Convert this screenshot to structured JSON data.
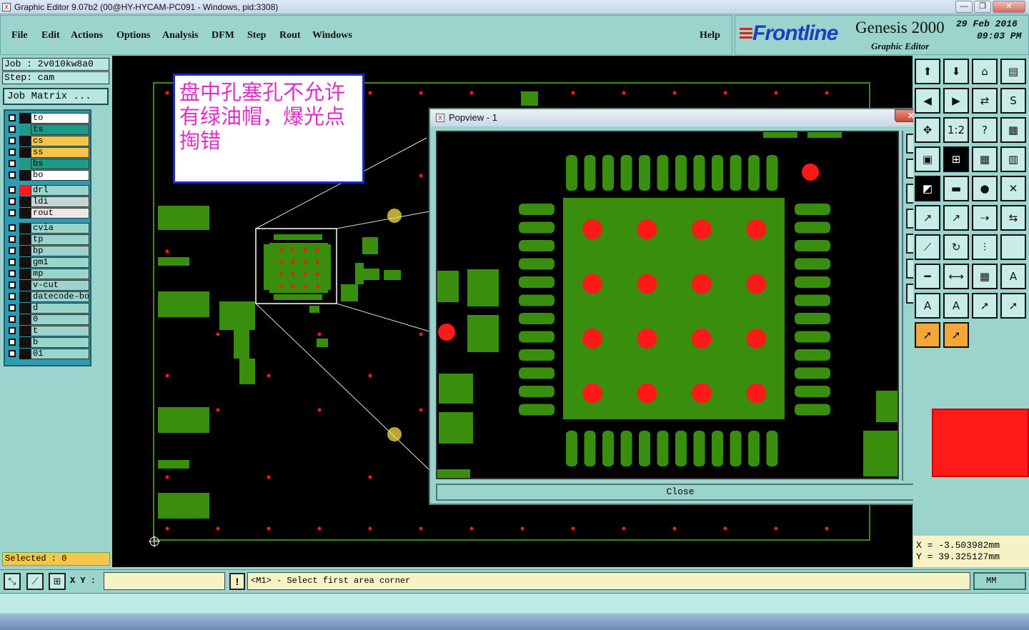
{
  "window": {
    "title": "Graphic Editor 9.07b2 (00@HY-HYCAM-PC091 - Windows, pid:3308)",
    "app_icon": "X",
    "minimize": "—",
    "maximize": "❐",
    "close": "✕"
  },
  "menu": {
    "items": [
      "File",
      "Edit",
      "Actions",
      "Options",
      "Analysis",
      "DFM",
      "Step",
      "Rout",
      "Windows"
    ],
    "help": "Help"
  },
  "brand": {
    "logo": "Frontline",
    "product": "Genesis 2000",
    "subtitle": "Graphic Editor",
    "date": "29 Feb 2016",
    "time": "09:03 PM"
  },
  "job": {
    "job_line": "Job : 2v010kw8a0",
    "step_line": "Step: cam",
    "matrix_button": "Job Matrix ..."
  },
  "layers": [
    {
      "name": "to",
      "color": "#111111",
      "bg": "#ffffff"
    },
    {
      "name": "ts",
      "color": "#1d9a86",
      "bg": "#1d9a86"
    },
    {
      "name": "cs",
      "color": "#111111",
      "bg": "#f3c64a"
    },
    {
      "name": "ss",
      "color": "#111111",
      "bg": "#f3c64a"
    },
    {
      "name": "bs",
      "color": "#1d9a86",
      "bg": "#1d9a86"
    },
    {
      "name": "bo",
      "color": "#111111",
      "bg": "#ffffff"
    },
    {
      "name": "drl",
      "color": "#ff1a1a",
      "bg": "#9bd4cc"
    },
    {
      "name": "ldi",
      "color": "#111111",
      "bg": "#c8d4d4"
    },
    {
      "name": "rout",
      "color": "#111111",
      "bg": "#e8e8e8"
    },
    {
      "name": "cvia",
      "color": "#111111",
      "bg": "#9bd4cc"
    },
    {
      "name": "tp",
      "color": "#111111",
      "bg": "#9bd4cc"
    },
    {
      "name": "bp",
      "color": "#111111",
      "bg": "#9bd4cc"
    },
    {
      "name": "gm1",
      "color": "#111111",
      "bg": "#9bd4cc"
    },
    {
      "name": "mp",
      "color": "#111111",
      "bg": "#9bd4cc"
    },
    {
      "name": "v-cut",
      "color": "#111111",
      "bg": "#9bd4cc"
    },
    {
      "name": "datecode-bo",
      "color": "#111111",
      "bg": "#9bd4cc"
    },
    {
      "name": "d",
      "color": "#111111",
      "bg": "#9bd4cc"
    },
    {
      "name": "0",
      "color": "#111111",
      "bg": "#9bd4cc"
    },
    {
      "name": "t",
      "color": "#111111",
      "bg": "#9bd4cc"
    },
    {
      "name": "b",
      "color": "#111111",
      "bg": "#9bd4cc"
    },
    {
      "name": "01",
      "color": "#111111",
      "bg": "#9bd4cc"
    }
  ],
  "selected": "Selected : 0",
  "annotation": "盘中孔塞孔不允许有绿油帽，爆光点掏错",
  "popview": {
    "title": "Popview - 1",
    "close_button": "Close",
    "close_x": "✕"
  },
  "coords": {
    "x": "X = -3.503982mm",
    "y": "Y = 39.325127mm"
  },
  "status": {
    "xy_label": "X Y :",
    "xy_value": "",
    "prompt_icon": "!",
    "prompt": "<M1> - Select first area corner",
    "units": "MM"
  },
  "colors": {
    "panel": "#9bd4cc",
    "copper": "#3a8e0e",
    "drill": "#ff1a1a",
    "annotation_text": "#e02ec8",
    "annotation_border": "#1b2ccf"
  }
}
